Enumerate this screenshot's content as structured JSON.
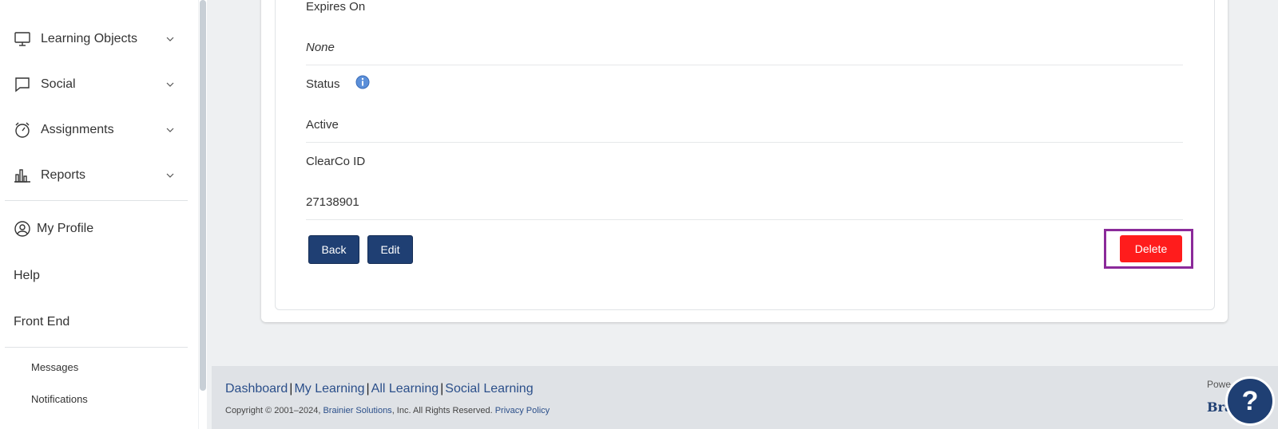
{
  "sidebar": {
    "items": [
      {
        "label": "Learning Objects",
        "icon": "monitor-icon"
      },
      {
        "label": "Social",
        "icon": "chat-bubble-icon"
      },
      {
        "label": "Assignments",
        "icon": "stopwatch-icon"
      },
      {
        "label": "Reports",
        "icon": "bar-chart-icon"
      }
    ],
    "my_profile": "My Profile",
    "help": "Help",
    "front_end": "Front End",
    "messages": "Messages",
    "notifications": "Notifications"
  },
  "details": {
    "expires_on_label": "Expires On",
    "expires_on_value": "None",
    "status_label": "Status",
    "status_value": "Active",
    "clearco_id_label": "ClearCo ID",
    "clearco_id_value": "27138901"
  },
  "actions": {
    "back": "Back",
    "edit": "Edit",
    "delete": "Delete"
  },
  "footer": {
    "links": [
      "Dashboard",
      "My Learning",
      "All Learning",
      "Social Learning"
    ],
    "copyright_prefix": "Copyright © 2001–2024, ",
    "company": "Brainier Solutions",
    "copyright_suffix": ", Inc. All Rights Reserved. ",
    "privacy": "Privacy Policy",
    "powered": "Powe",
    "brand": "Bra"
  },
  "help_fab": "?",
  "colors": {
    "navy": "#1f3f73",
    "danger": "#ff1c1c",
    "highlight": "#8b2a9a",
    "info": "#5b8fd9"
  }
}
